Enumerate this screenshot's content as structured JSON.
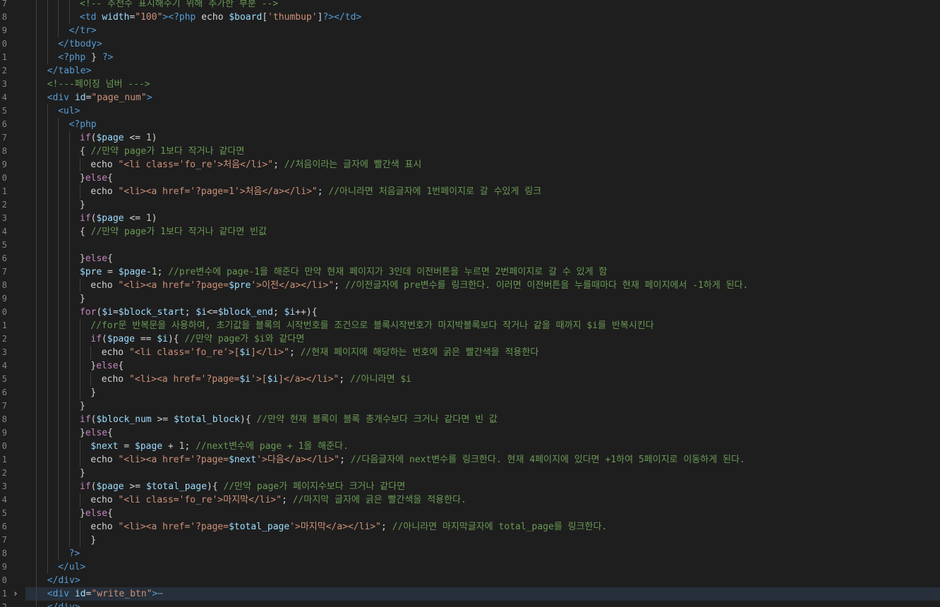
{
  "colors": {
    "background": "#1e1e1e",
    "line_number": "#858585",
    "tag": "#569cd6",
    "attribute": "#9cdcfe",
    "string": "#ce9178",
    "comment": "#6a9955",
    "keyword": "#c586c0",
    "variable": "#9cdcfe",
    "number": "#b5cea8",
    "plain": "#d4d4d4",
    "current_line": "#262f3a"
  },
  "editor": {
    "lines": [
      {
        "no": "7",
        "indent": 5,
        "segs": [
          [
            "cmt",
            "<!-- 추천수 표시해주기 위해 추가한 부분 -->"
          ]
        ]
      },
      {
        "no": "8",
        "indent": 5,
        "segs": [
          [
            "tag",
            "<td "
          ],
          [
            "attr",
            "width"
          ],
          [
            "plain",
            "="
          ],
          [
            "str",
            "\"100\""
          ],
          [
            "tag",
            ">"
          ],
          [
            "php",
            "<?php "
          ],
          [
            "plain",
            "echo "
          ],
          [
            "var",
            "$board"
          ],
          [
            "plain",
            "["
          ],
          [
            "str",
            "'thumbup'"
          ],
          [
            "plain",
            "]"
          ],
          [
            "php",
            "?>"
          ],
          [
            "tag",
            "</td>"
          ]
        ]
      },
      {
        "no": "9",
        "indent": 4,
        "segs": [
          [
            "tag",
            "</tr>"
          ]
        ]
      },
      {
        "no": "0",
        "indent": 3,
        "segs": [
          [
            "tag",
            "</tbody>"
          ]
        ]
      },
      {
        "no": "1",
        "indent": 3,
        "segs": [
          [
            "php",
            "<?php "
          ],
          [
            "plain",
            "} "
          ],
          [
            "php",
            "?>"
          ]
        ]
      },
      {
        "no": "2",
        "indent": 2,
        "segs": [
          [
            "tag",
            "</table>"
          ]
        ]
      },
      {
        "no": "3",
        "indent": 2,
        "segs": [
          [
            "cmt",
            "<!---페이징 넘버 --->"
          ]
        ]
      },
      {
        "no": "4",
        "indent": 2,
        "segs": [
          [
            "tag",
            "<div "
          ],
          [
            "attr",
            "id"
          ],
          [
            "plain",
            "="
          ],
          [
            "str",
            "\"page_num\""
          ],
          [
            "tag",
            ">"
          ]
        ]
      },
      {
        "no": "5",
        "indent": 3,
        "segs": [
          [
            "tag",
            "<ul>"
          ]
        ]
      },
      {
        "no": "6",
        "indent": 4,
        "segs": [
          [
            "php",
            "<?php"
          ]
        ]
      },
      {
        "no": "7",
        "indent": 5,
        "segs": [
          [
            "kw",
            "if"
          ],
          [
            "plain",
            "("
          ],
          [
            "var",
            "$page"
          ],
          [
            "plain",
            " <= "
          ],
          [
            "num",
            "1"
          ],
          [
            "plain",
            ")"
          ]
        ]
      },
      {
        "no": "8",
        "indent": 5,
        "segs": [
          [
            "plain",
            "{ "
          ],
          [
            "cmt",
            "//만약 page가 1보다 작거나 같다면"
          ]
        ]
      },
      {
        "no": "9",
        "indent": 6,
        "segs": [
          [
            "plain",
            "echo "
          ],
          [
            "str",
            "\"<li class='fo_re'>처음</li>\""
          ],
          [
            "plain",
            "; "
          ],
          [
            "cmt",
            "//처음이라는 글자에 빨간색 표시"
          ]
        ]
      },
      {
        "no": "0",
        "indent": 5,
        "segs": [
          [
            "plain",
            "}"
          ],
          [
            "kw",
            "else"
          ],
          [
            "plain",
            "{"
          ]
        ]
      },
      {
        "no": "1",
        "indent": 6,
        "segs": [
          [
            "plain",
            "echo "
          ],
          [
            "str",
            "\"<li><a href='?page=1'>처음</a></li>\""
          ],
          [
            "plain",
            "; "
          ],
          [
            "cmt",
            "//아니라면 처음글자에 1번페이지로 갈 수있게 링크"
          ]
        ]
      },
      {
        "no": "2",
        "indent": 5,
        "segs": [
          [
            "plain",
            "}"
          ]
        ]
      },
      {
        "no": "3",
        "indent": 5,
        "segs": [
          [
            "kw",
            "if"
          ],
          [
            "plain",
            "("
          ],
          [
            "var",
            "$page"
          ],
          [
            "plain",
            " <= "
          ],
          [
            "num",
            "1"
          ],
          [
            "plain",
            ")"
          ]
        ]
      },
      {
        "no": "4",
        "indent": 5,
        "segs": [
          [
            "plain",
            "{ "
          ],
          [
            "cmt",
            "//만약 page가 1보다 작거나 같다면 빈값"
          ]
        ]
      },
      {
        "no": "5",
        "indent": 5,
        "segs": []
      },
      {
        "no": "6",
        "indent": 5,
        "segs": [
          [
            "plain",
            "}"
          ],
          [
            "kw",
            "else"
          ],
          [
            "plain",
            "{"
          ]
        ]
      },
      {
        "no": "7",
        "indent": 5,
        "segs": [
          [
            "var",
            "$pre"
          ],
          [
            "plain",
            " = "
          ],
          [
            "var",
            "$page"
          ],
          [
            "plain",
            "-"
          ],
          [
            "num",
            "1"
          ],
          [
            "plain",
            "; "
          ],
          [
            "cmt",
            "//pre변수에 page-1을 해준다 만약 현재 페이지가 3인데 이전버튼을 누르면 2번페이지로 갈 수 있게 함"
          ]
        ]
      },
      {
        "no": "8",
        "indent": 6,
        "segs": [
          [
            "plain",
            "echo "
          ],
          [
            "str",
            "\"<li><a href='?page="
          ],
          [
            "var",
            "$pre"
          ],
          [
            "str",
            "'>이전</a></li>\""
          ],
          [
            "plain",
            "; "
          ],
          [
            "cmt",
            "//이전글자에 pre변수를 링크한다. 이러면 이전버튼을 누를때마다 현재 페이지에서 -1하게 된다."
          ]
        ]
      },
      {
        "no": "9",
        "indent": 5,
        "segs": [
          [
            "plain",
            "}"
          ]
        ]
      },
      {
        "no": "0",
        "indent": 5,
        "segs": [
          [
            "kw",
            "for"
          ],
          [
            "plain",
            "("
          ],
          [
            "var",
            "$i"
          ],
          [
            "plain",
            "="
          ],
          [
            "var",
            "$block_start"
          ],
          [
            "plain",
            "; "
          ],
          [
            "var",
            "$i"
          ],
          [
            "plain",
            "<="
          ],
          [
            "var",
            "$block_end"
          ],
          [
            "plain",
            "; "
          ],
          [
            "var",
            "$i"
          ],
          [
            "plain",
            "++){"
          ]
        ]
      },
      {
        "no": "1",
        "indent": 6,
        "segs": [
          [
            "cmt",
            "//for문 반복문을 사용하여, 초기값을 블록의 시작번호를 조건으로 블록시작번호가 마지박블록보다 작거나 같을 때까지 $i를 반복시킨다"
          ]
        ]
      },
      {
        "no": "2",
        "indent": 6,
        "segs": [
          [
            "kw",
            "if"
          ],
          [
            "plain",
            "("
          ],
          [
            "var",
            "$page"
          ],
          [
            "plain",
            " == "
          ],
          [
            "var",
            "$i"
          ],
          [
            "plain",
            "){ "
          ],
          [
            "cmt",
            "//만약 page가 $i와 같다면"
          ]
        ]
      },
      {
        "no": "3",
        "indent": 7,
        "segs": [
          [
            "plain",
            "echo "
          ],
          [
            "str",
            "\"<li class='fo_re'>["
          ],
          [
            "var",
            "$i"
          ],
          [
            "str",
            "]</li>\""
          ],
          [
            "plain",
            "; "
          ],
          [
            "cmt",
            "//현재 페이지에 해당하는 번호에 굵은 빨간색을 적용한다"
          ]
        ]
      },
      {
        "no": "4",
        "indent": 6,
        "segs": [
          [
            "plain",
            "}"
          ],
          [
            "kw",
            "else"
          ],
          [
            "plain",
            "{"
          ]
        ]
      },
      {
        "no": "5",
        "indent": 7,
        "segs": [
          [
            "plain",
            "echo "
          ],
          [
            "str",
            "\"<li><a href='?page="
          ],
          [
            "var",
            "$i"
          ],
          [
            "str",
            "'>["
          ],
          [
            "var",
            "$i"
          ],
          [
            "str",
            "]</a></li>\""
          ],
          [
            "plain",
            "; "
          ],
          [
            "cmt",
            "//아니라면 $i"
          ]
        ]
      },
      {
        "no": "6",
        "indent": 6,
        "segs": [
          [
            "plain",
            "}"
          ]
        ]
      },
      {
        "no": "7",
        "indent": 5,
        "segs": [
          [
            "plain",
            "}"
          ]
        ]
      },
      {
        "no": "8",
        "indent": 5,
        "segs": [
          [
            "kw",
            "if"
          ],
          [
            "plain",
            "("
          ],
          [
            "var",
            "$block_num"
          ],
          [
            "plain",
            " >= "
          ],
          [
            "var",
            "$total_block"
          ],
          [
            "plain",
            "){ "
          ],
          [
            "cmt",
            "//만약 현재 블록이 블록 총개수보다 크거나 같다면 빈 값"
          ]
        ]
      },
      {
        "no": "9",
        "indent": 5,
        "segs": [
          [
            "plain",
            "}"
          ],
          [
            "kw",
            "else"
          ],
          [
            "plain",
            "{"
          ]
        ]
      },
      {
        "no": "0",
        "indent": 6,
        "segs": [
          [
            "var",
            "$next"
          ],
          [
            "plain",
            " = "
          ],
          [
            "var",
            "$page"
          ],
          [
            "plain",
            " + "
          ],
          [
            "num",
            "1"
          ],
          [
            "plain",
            "; "
          ],
          [
            "cmt",
            "//next변수에 page + 1을 해준다."
          ]
        ]
      },
      {
        "no": "1",
        "indent": 6,
        "segs": [
          [
            "plain",
            "echo "
          ],
          [
            "str",
            "\"<li><a href='?page="
          ],
          [
            "var",
            "$next"
          ],
          [
            "str",
            "'>다음</a></li>\""
          ],
          [
            "plain",
            "; "
          ],
          [
            "cmt",
            "//다음글자에 next변수를 링크한다. 현재 4페이지에 있다면 +1하여 5페이지로 이동하게 된다."
          ]
        ]
      },
      {
        "no": "2",
        "indent": 5,
        "segs": [
          [
            "plain",
            "}"
          ]
        ]
      },
      {
        "no": "3",
        "indent": 5,
        "segs": [
          [
            "kw",
            "if"
          ],
          [
            "plain",
            "("
          ],
          [
            "var",
            "$page"
          ],
          [
            "plain",
            " >= "
          ],
          [
            "var",
            "$total_page"
          ],
          [
            "plain",
            "){ "
          ],
          [
            "cmt",
            "//만약 page가 페이지수보다 크거나 같다면"
          ]
        ]
      },
      {
        "no": "4",
        "indent": 6,
        "segs": [
          [
            "plain",
            "echo "
          ],
          [
            "str",
            "\"<li class='fo_re'>마지막</li>\""
          ],
          [
            "plain",
            "; "
          ],
          [
            "cmt",
            "//마지막 글자에 긁은 빨간색을 적용한다."
          ]
        ]
      },
      {
        "no": "5",
        "indent": 5,
        "segs": [
          [
            "plain",
            "}"
          ],
          [
            "kw",
            "else"
          ],
          [
            "plain",
            "{"
          ]
        ]
      },
      {
        "no": "6",
        "indent": 6,
        "segs": [
          [
            "plain",
            "echo "
          ],
          [
            "str",
            "\"<li><a href='?page="
          ],
          [
            "var",
            "$total_page"
          ],
          [
            "str",
            "'>마지막</a></li>\""
          ],
          [
            "plain",
            "; "
          ],
          [
            "cmt",
            "//아니라면 마지막글자에 total_page를 링크한다."
          ]
        ]
      },
      {
        "no": "7",
        "indent": 6,
        "segs": [
          [
            "plain",
            "}"
          ]
        ]
      },
      {
        "no": "8",
        "indent": 4,
        "segs": [
          [
            "php",
            "?>"
          ]
        ]
      },
      {
        "no": "9",
        "indent": 3,
        "segs": [
          [
            "tag",
            "</ul>"
          ]
        ]
      },
      {
        "no": "0",
        "indent": 2,
        "segs": [
          [
            "tag",
            "</div>"
          ]
        ]
      },
      {
        "no": "1",
        "indent": 2,
        "fold": "›",
        "current": true,
        "segs": [
          [
            "tag",
            "<div "
          ],
          [
            "attr",
            "id"
          ],
          [
            "plain",
            "="
          ],
          [
            "str",
            "\"write_btn\""
          ],
          [
            "tag",
            ">"
          ],
          [
            "ell",
            "⋯"
          ]
        ]
      },
      {
        "no": "2",
        "indent": 2,
        "segs": [
          [
            "tag",
            "</div>"
          ]
        ]
      }
    ]
  }
}
